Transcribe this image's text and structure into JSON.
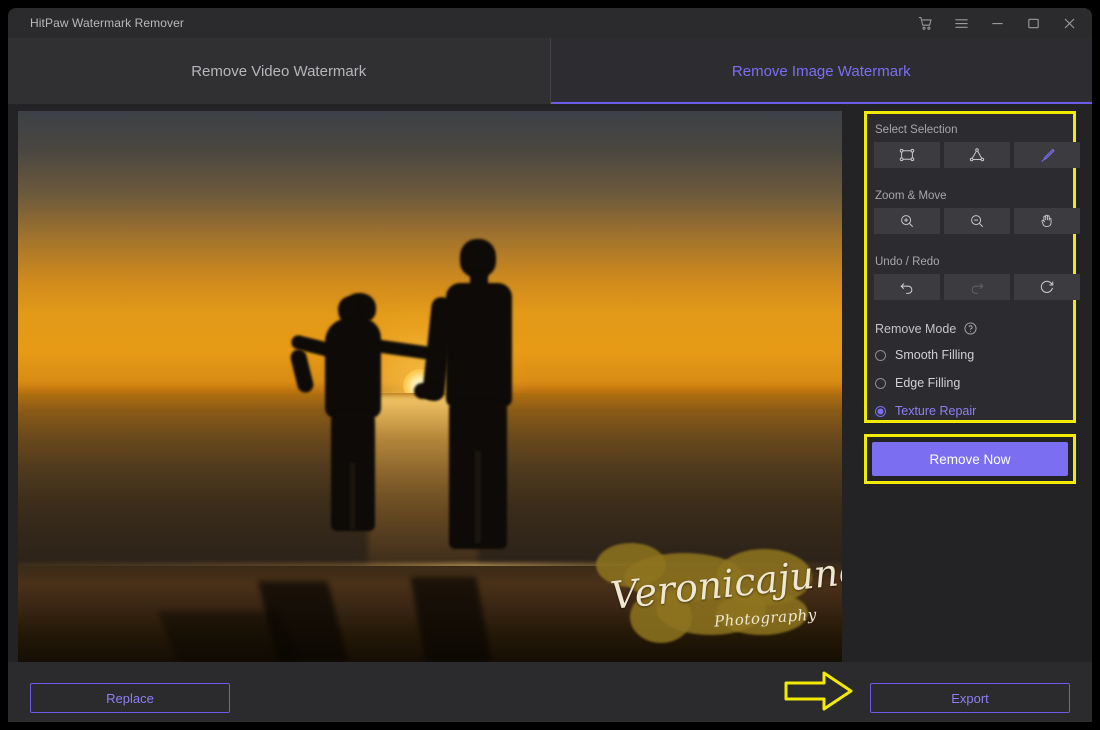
{
  "window": {
    "title": "HitPaw Watermark Remover",
    "controls": [
      {
        "name": "cart-icon",
        "glyph": "cart"
      },
      {
        "name": "menu-icon",
        "glyph": "menu"
      },
      {
        "name": "minimize-icon",
        "glyph": "minimize"
      },
      {
        "name": "maximize-icon",
        "glyph": "maximize"
      },
      {
        "name": "close-icon",
        "glyph": "close"
      }
    ]
  },
  "tabs": [
    {
      "label": "Remove Video Watermark",
      "active": false
    },
    {
      "label": "Remove Image Watermark",
      "active": true
    }
  ],
  "canvas": {
    "watermark_line1": "Veronicajune",
    "watermark_line2": "Photography"
  },
  "panel": {
    "sections": [
      {
        "label": "Select Selection",
        "tools": [
          {
            "name": "rectangle-select-icon",
            "label": "Rectangle Select",
            "state": "normal"
          },
          {
            "name": "polygon-select-icon",
            "label": "Polygon Select",
            "state": "normal"
          },
          {
            "name": "brush-select-icon",
            "label": "Brush Select",
            "state": "active"
          }
        ]
      },
      {
        "label": "Zoom & Move",
        "tools": [
          {
            "name": "zoom-in-icon",
            "label": "Zoom In",
            "state": "normal"
          },
          {
            "name": "zoom-out-icon",
            "label": "Zoom Out",
            "state": "normal"
          },
          {
            "name": "pan-hand-icon",
            "label": "Pan",
            "state": "normal"
          }
        ]
      },
      {
        "label": "Undo / Redo",
        "tools": [
          {
            "name": "undo-icon",
            "label": "Undo",
            "state": "normal"
          },
          {
            "name": "redo-icon",
            "label": "Redo",
            "state": "disabled"
          },
          {
            "name": "reset-icon",
            "label": "Reset",
            "state": "normal"
          }
        ]
      }
    ],
    "remove_mode": {
      "label": "Remove Mode",
      "help_icon": "help-circle-icon",
      "options": [
        {
          "label": "Smooth Filling",
          "selected": false
        },
        {
          "label": "Edge Filling",
          "selected": false
        },
        {
          "label": "Texture Repair",
          "selected": true
        }
      ]
    },
    "remove_now_label": "Remove Now"
  },
  "bottom": {
    "replace_label": "Replace",
    "export_label": "Export"
  },
  "colors": {
    "accent_purple": "#7b6ef0",
    "annotation_yellow": "#f2ea00",
    "window_bg": "#232326",
    "panel_bg": "#2c2c30",
    "titlebar_bg": "#2b2b2e"
  }
}
